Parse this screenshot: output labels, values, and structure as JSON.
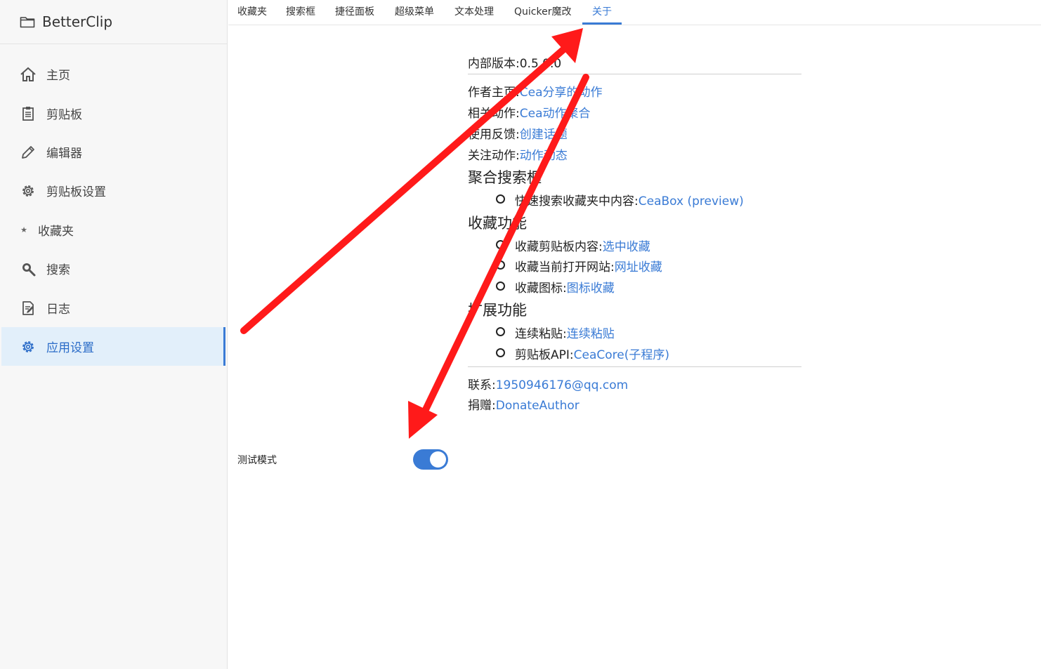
{
  "app": {
    "title": "BetterClip"
  },
  "sidebar": {
    "items": [
      {
        "label": "主页",
        "icon": "home-icon"
      },
      {
        "label": "剪贴板",
        "icon": "clipboard-icon"
      },
      {
        "label": "编辑器",
        "icon": "pencil-icon"
      },
      {
        "label": "剪贴板设置",
        "icon": "gear-icon"
      },
      {
        "label": "收藏夹",
        "icon": "star-icon"
      },
      {
        "label": "搜索",
        "icon": "search-icon"
      },
      {
        "label": "日志",
        "icon": "log-icon"
      },
      {
        "label": "应用设置",
        "icon": "gear-icon",
        "active": true
      }
    ]
  },
  "tabs": [
    {
      "label": "收藏夹"
    },
    {
      "label": "搜索框"
    },
    {
      "label": "捷径面板"
    },
    {
      "label": "超级菜单"
    },
    {
      "label": "文本处理"
    },
    {
      "label": "Quicker魔改"
    },
    {
      "label": "关于",
      "active": true
    }
  ],
  "about": {
    "version_label": "内部版本:",
    "version_value": "0.5.0.0",
    "author_label": "作者主页:",
    "author_link": "Cea分享的动作",
    "related_label": "相关动作:",
    "related_link": "Cea动作聚合",
    "feedback_label": "使用反馈:",
    "feedback_link": "创建话题",
    "follow_label": "关注动作:",
    "follow_link": "动作动态",
    "sections": {
      "search": {
        "heading": "聚合搜索框",
        "items": [
          {
            "label": "快速搜索收藏夹中内容:",
            "link": "CeaBox (preview)"
          }
        ]
      },
      "favorite": {
        "heading": "收藏功能",
        "items": [
          {
            "label": "收藏剪贴板内容:",
            "link": "选中收藏"
          },
          {
            "label": "收藏当前打开网站:",
            "link": "网址收藏"
          },
          {
            "label": "收藏图标:",
            "link": "图标收藏"
          }
        ]
      },
      "extension": {
        "heading": "扩展功能",
        "items": [
          {
            "label": "连续粘贴:",
            "link": "连续粘贴"
          },
          {
            "label": "剪贴板API:",
            "link": "CeaCore(子程序)"
          }
        ]
      }
    },
    "contact_label": "联系:",
    "contact_link": "1950946176@qq.com",
    "donate_label": "捐赠:",
    "donate_link": "DonateAuthor"
  },
  "settings": {
    "test_mode_label": "测试模式",
    "test_mode_on": true
  },
  "colors": {
    "accent": "#3a7bd5",
    "annotation_arrow": "#ff1a1a",
    "active_bg": "#e2effa"
  }
}
